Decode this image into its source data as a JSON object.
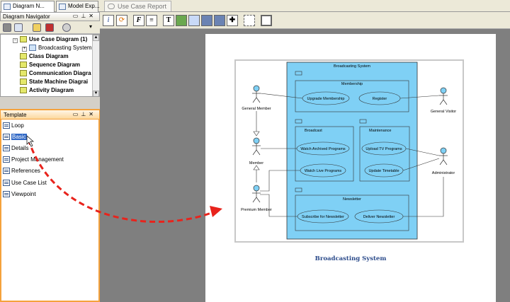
{
  "left_tabs": [
    {
      "label": "Diagram N...",
      "active": true
    },
    {
      "label": "Model Exp...",
      "active": false
    }
  ],
  "navigator": {
    "title": "Diagram Navigator",
    "items": [
      {
        "label": "Use Case Diagram (1)",
        "bold": true
      },
      {
        "label": "Broadcasting System",
        "bold": false
      },
      {
        "label": "Class Diagram",
        "bold": true
      },
      {
        "label": "Sequence Diagram",
        "bold": true
      },
      {
        "label": "Communication Diagra",
        "bold": true
      },
      {
        "label": "State Machine Diagrai",
        "bold": true
      },
      {
        "label": "Activity Diagram",
        "bold": true
      }
    ]
  },
  "template": {
    "title": "Template",
    "items": [
      {
        "label": "Loop"
      },
      {
        "label": "Basic",
        "selected": true
      },
      {
        "label": "Details"
      },
      {
        "label": "Project Management"
      },
      {
        "label": "References"
      },
      {
        "label": "Use Case List"
      },
      {
        "label": "Viewpoint"
      }
    ]
  },
  "doc_tab": {
    "label": "Use Case Report"
  },
  "format_toolbar": {
    "buttons": [
      "info-icon",
      "refresh-icon",
      "font-icon",
      "paragraph-icon",
      "text-box-icon",
      "image-icon",
      "table-icon",
      "page-break-icon",
      "page-break-2-icon",
      "add-icon",
      "frame-icon",
      "page-icon"
    ],
    "font_glyph": "F",
    "text_glyph": "T",
    "plus_glyph": "✚"
  },
  "diagram": {
    "system_title": "Broadcasting System",
    "packages": {
      "membership": "Membership",
      "broadcast": "Broadcast",
      "maintenance": "Maintenance",
      "newsletter": "Newsletter"
    },
    "use_cases": {
      "upgrade": "Upgrade Membership",
      "register": "Register",
      "watch_archived": "Watch Archived Programs",
      "watch_live": "Watch Live Programs",
      "upload_tv": "Upload TV Programs",
      "update_timetable": "Update Timetable",
      "subscribe": "Subscribe for Newsletter",
      "deliver": "Deliver Newsletter"
    },
    "actors": {
      "general_member": "General Member",
      "member": "Member",
      "premium_member": "Premium Member",
      "general_visitor": "General Visitor",
      "administrator": "Administrator"
    },
    "caption": "Broadcasting System"
  },
  "colors": {
    "system_fill": "#7fd0f5",
    "actor_head": "#7fd0f5",
    "drag_arrow": "#e8231c",
    "template_border": "#f5a23c",
    "selection": "#3169c6"
  }
}
